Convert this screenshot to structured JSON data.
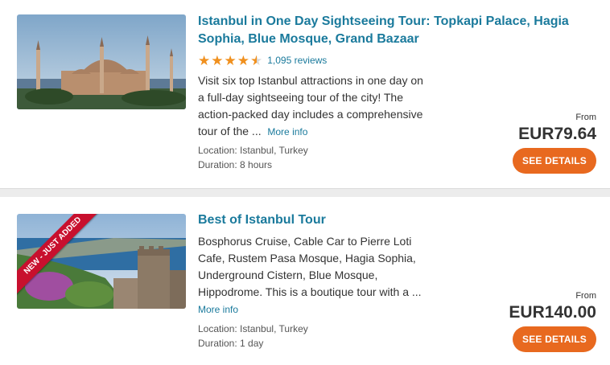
{
  "tours": [
    {
      "title": "Istanbul in One Day Sightseeing Tour: Topkapi Palace, Hagia Sophia, Blue Mosque, Grand Bazaar",
      "rating": 4.5,
      "reviews": "1,095 reviews",
      "description": "Visit six top Istanbul attractions in one day on a full-day sightseeing tour of the city! The action-packed day includes a comprehensive tour of the ...",
      "more_info": "More info",
      "location": "Location: Istanbul, Turkey",
      "duration": "Duration: 8 hours",
      "from_label": "From",
      "price": "EUR79.64",
      "button": "SEE DETAILS"
    },
    {
      "title": "Best of Istanbul Tour",
      "badge": "NEW - JUST ADDED",
      "description": "Bosphorus Cruise, Cable Car to Pierre Loti Cafe, Rustem Pasa Mosque, Hagia Sophia, Underground Cistern, Blue Mosque, Hippodrome. This is a boutique tour with a ...",
      "more_info": "More info",
      "location": "Location: Istanbul, Turkey",
      "duration": "Duration: 1 day",
      "from_label": "From",
      "price": "EUR140.00",
      "button": "SEE DETAILS"
    }
  ],
  "colors": {
    "link": "#1a7a9c",
    "button": "#e8691f",
    "star": "#f0901e",
    "badge": "#c8102e"
  }
}
